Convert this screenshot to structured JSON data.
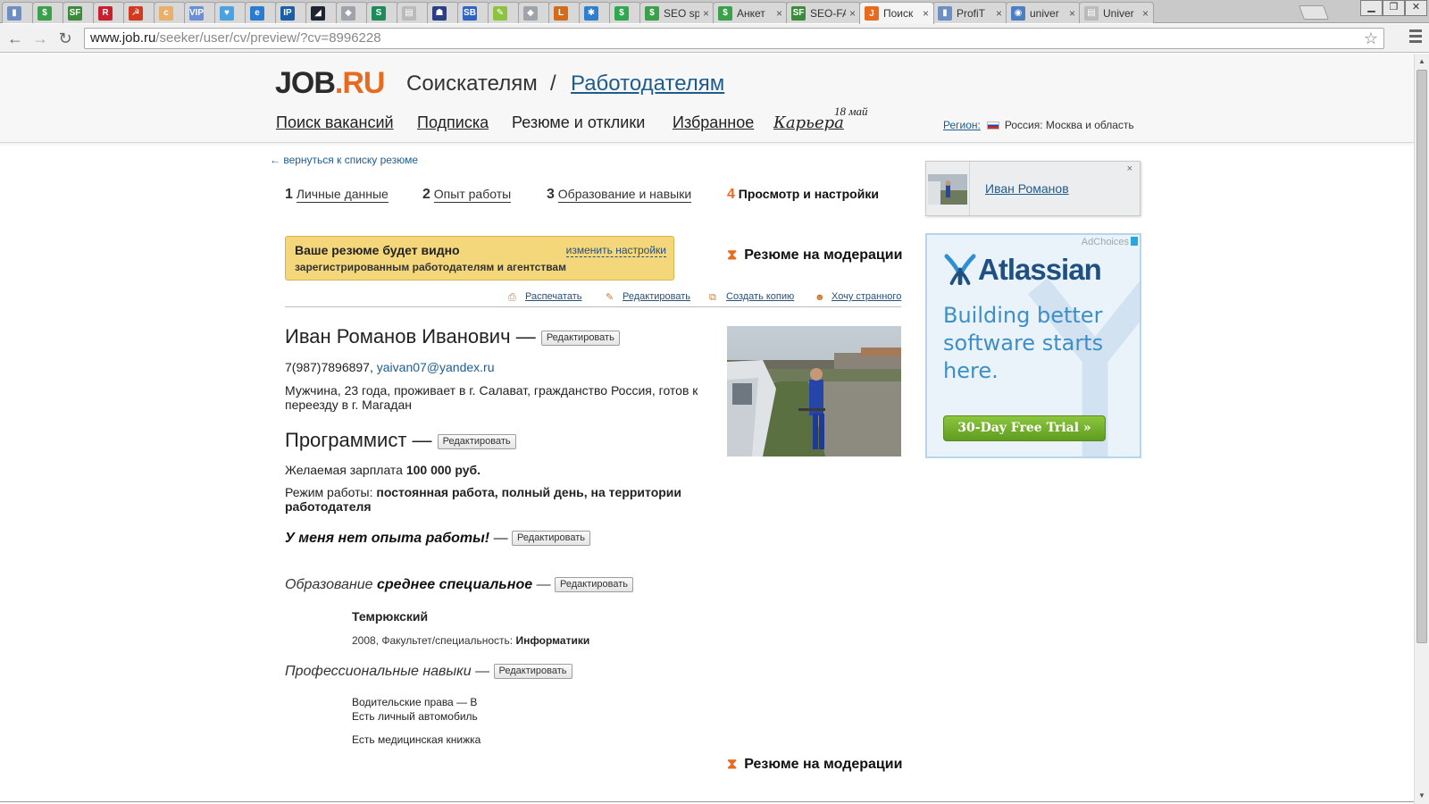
{
  "browser": {
    "tabs": [
      {
        "title": "",
        "color": "#6d8fc4",
        "glyph": "▮"
      },
      {
        "title": "",
        "color": "#3aa14a",
        "glyph": "$"
      },
      {
        "title": "",
        "color": "#3b8b3b",
        "glyph": "SF"
      },
      {
        "title": "",
        "color": "#c8202f",
        "glyph": "R"
      },
      {
        "title": "",
        "color": "#d23b1f",
        "glyph": "☭"
      },
      {
        "title": "",
        "color": "#e8b06a",
        "glyph": "c"
      },
      {
        "title": "",
        "color": "#6a8fd6",
        "glyph": "VIP"
      },
      {
        "title": "",
        "color": "#4aa3e0",
        "glyph": "♥"
      },
      {
        "title": "",
        "color": "#2b7bd1",
        "glyph": "e"
      },
      {
        "title": "",
        "color": "#1a5fa8",
        "glyph": "IP"
      },
      {
        "title": "",
        "color": "#1d2533",
        "glyph": "◢"
      },
      {
        "title": "",
        "color": "#9ea4aa",
        "glyph": "◆"
      },
      {
        "title": "",
        "color": "#1f8a5a",
        "glyph": "S"
      },
      {
        "title": "",
        "color": "#bbbbbb",
        "glyph": "▤"
      },
      {
        "title": "",
        "color": "#2a3f86",
        "glyph": "☗"
      },
      {
        "title": "",
        "color": "#2d64c6",
        "glyph": "SB"
      },
      {
        "title": "",
        "color": "#8ec33f",
        "glyph": "✎"
      },
      {
        "title": "",
        "color": "#9ea4aa",
        "glyph": "◆"
      },
      {
        "title": "",
        "color": "#d46b1a",
        "glyph": "L"
      },
      {
        "title": "",
        "color": "#2f7fd1",
        "glyph": "✱"
      },
      {
        "title": "",
        "color": "#2fa84f",
        "glyph": "$"
      },
      {
        "title": "SEO sp",
        "color": "#3aa14a",
        "glyph": "$"
      },
      {
        "title": "Анкет",
        "color": "#3aa14a",
        "glyph": "$"
      },
      {
        "title": "SEO-FA",
        "color": "#3b8b3b",
        "glyph": "SF"
      },
      {
        "title": "Поиск",
        "color": "#e86a1f",
        "glyph": "J",
        "active": true
      },
      {
        "title": "ProfiT",
        "color": "#6d8fc4",
        "glyph": "▮"
      },
      {
        "title": "univer",
        "color": "#4a7fc2",
        "glyph": "◉"
      },
      {
        "title": "Univer",
        "color": "#bbbbbb",
        "glyph": "▤"
      }
    ],
    "url_domain": "www.job.ru",
    "url_path": "/seeker/user/cv/preview/?cv=8996228"
  },
  "header": {
    "logo_job": "JOB",
    "logo_dot": ".",
    "logo_ru": "RU",
    "section_seekers": "Соискателям",
    "slash": "/",
    "section_employers": "Работодателям",
    "nav": {
      "search": "Поиск вакансий",
      "subscription": "Подписка",
      "resumes": "Резюме и отклики",
      "favorites": "Избранное",
      "career": "Карьера",
      "career_date": "18 май"
    },
    "region_label": "Регион:",
    "region_value": "Россия: Москва и область"
  },
  "page": {
    "back_link": "← вернуться к списку резюме",
    "steps": [
      {
        "num": "1",
        "label": "Личные данные"
      },
      {
        "num": "2",
        "label": "Опыт работы"
      },
      {
        "num": "3",
        "label": "Образование и навыки"
      },
      {
        "num": "4",
        "label": "Просмотр и настройки"
      }
    ],
    "visibility_title": "Ваше резюме будет видно",
    "visibility_sub": "зарегистрированным работодателям и агентствам",
    "visibility_link": "изменить настройки",
    "moderation": "Резюме на модерации",
    "actions": {
      "print": "Распечатать",
      "edit": "Редактировать",
      "copy": "Создать копию",
      "strange": "Хочу странного"
    },
    "edit_label": "Редактировать",
    "dash": "—",
    "name": "Иван Романов Иванович",
    "phone": "7(987)7896897,",
    "email": "yaivan07@yandex.ru",
    "bio": "Мужчина, 23 года, проживает в г. Салават, гражданство Россия, готов к переезду в г. Магадан",
    "position": "Программист",
    "salary_label": "Желаемая зарплата",
    "salary_value": "100 000 руб.",
    "schedule_label": "Режим работы:",
    "schedule_value": "постоянная работа, полный день, на территории работодателя",
    "no_experience": "У меня нет опыта работы!",
    "edu_label": "Образование",
    "edu_value": "среднее специальное",
    "school": "Темрюкский",
    "school_info_prefix": "2008, Факультет/специальность:",
    "school_info_value": "Информатики",
    "skills_heading": "Профессиональные навыки",
    "skills": {
      "license": "Водительские права — B",
      "car": "Есть личный автомобиль",
      "medical": "Есть медицинская книжка"
    }
  },
  "sidebar": {
    "user_name": "Иван Романов",
    "close": "×",
    "ad": {
      "adchoices": "AdChoices",
      "brand": "Atlassian",
      "tagline": "Building better software starts here.",
      "cta": "30-Day Free Trial »"
    }
  },
  "icons": {
    "back": "arrow-left-icon",
    "forward": "arrow-right-icon",
    "reload": "reload-icon",
    "star": "star-icon",
    "hourglass": "hourglass-icon"
  },
  "colors": {
    "brand_orange": "#e86a1f",
    "link_blue": "#1f5c8e",
    "notice_yellow": "#f4d77b",
    "atlassian_blue": "#205081",
    "cta_green": "#7ab536"
  }
}
